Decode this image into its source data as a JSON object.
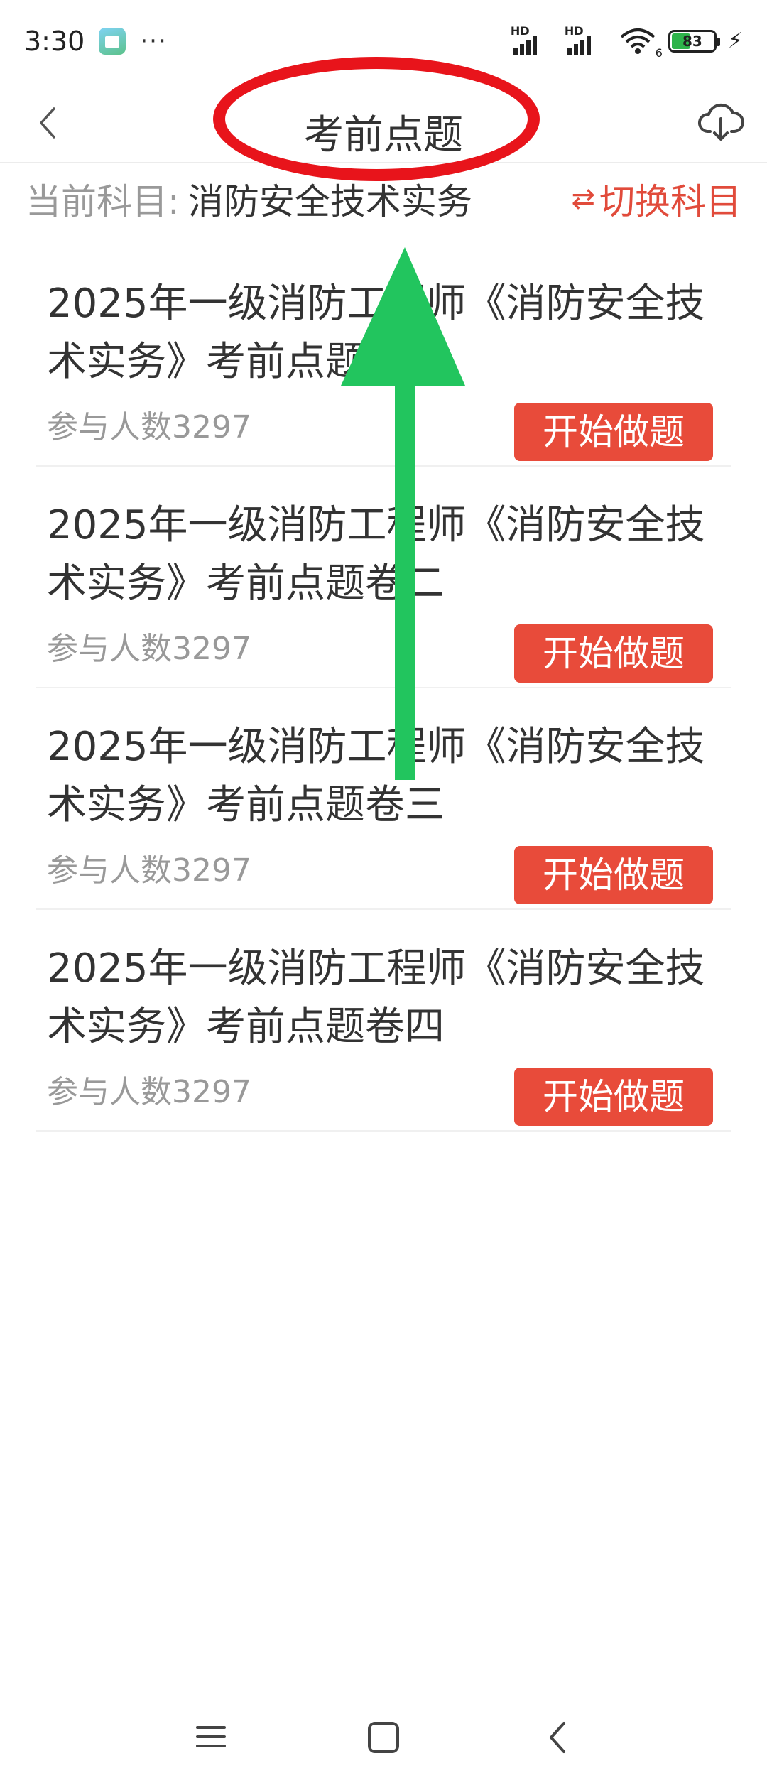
{
  "status_bar": {
    "time": "3:30",
    "more": "···",
    "signal_label_1": "HD",
    "signal_label_2": "HD",
    "wifi_sub": "6",
    "battery": "83"
  },
  "header": {
    "title": "考前点题",
    "back_icon": "chevron-left-icon",
    "download_icon": "cloud-download-icon"
  },
  "subject": {
    "label": "当前科目:",
    "value": "消防安全技术实务",
    "switch_label": "切换科目",
    "switch_icon": "⇄"
  },
  "papers": [
    {
      "title": "2025年一级消防工程师《消防安全技术实务》考前点题卷一",
      "count": "参与人数3297",
      "button": "开始做题"
    },
    {
      "title": "2025年一级消防工程师《消防安全技术实务》考前点题卷二",
      "count": "参与人数3297",
      "button": "开始做题"
    },
    {
      "title": "2025年一级消防工程师《消防安全技术实务》考前点题卷三",
      "count": "参与人数3297",
      "button": "开始做题"
    },
    {
      "title": "2025年一级消防工程师《消防安全技术实务》考前点题卷四",
      "count": "参与人数3297",
      "button": "开始做题"
    }
  ],
  "colors": {
    "accent": "#e84b3a",
    "annotation_circle": "#e8141b",
    "annotation_arrow": "#22c55e",
    "battery_fill": "#2fb34b"
  }
}
